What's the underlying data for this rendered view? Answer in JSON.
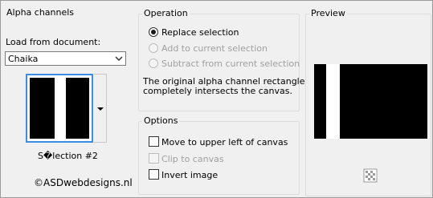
{
  "alpha": {
    "title": "Alpha channels",
    "load_label": "Load from document:",
    "document_value": "Chaika",
    "selection_name": "S�lection #2",
    "copyright": "©ASDwebdesigns.nl"
  },
  "operation": {
    "title": "Operation",
    "options": [
      {
        "label": "Replace selection",
        "selected": true,
        "enabled": true
      },
      {
        "label": "Add to current selection",
        "selected": false,
        "enabled": false
      },
      {
        "label": "Subtract from current selection",
        "selected": false,
        "enabled": false
      }
    ],
    "note_line1": "The original alpha channel rectangle",
    "note_line2": "completely intersects the canvas."
  },
  "options": {
    "title": "Options",
    "items": [
      {
        "label": "Move to upper left of canvas",
        "checked": false,
        "enabled": true
      },
      {
        "label": "Clip to canvas",
        "checked": false,
        "enabled": false
      },
      {
        "label": "Invert image",
        "checked": false,
        "enabled": true
      }
    ]
  },
  "preview": {
    "title": "Preview"
  },
  "icons": {
    "dropdown": "chevron-down-icon",
    "thumb_dropdown": "triangle-down-icon",
    "zoom": "transparency-grid-icon"
  }
}
